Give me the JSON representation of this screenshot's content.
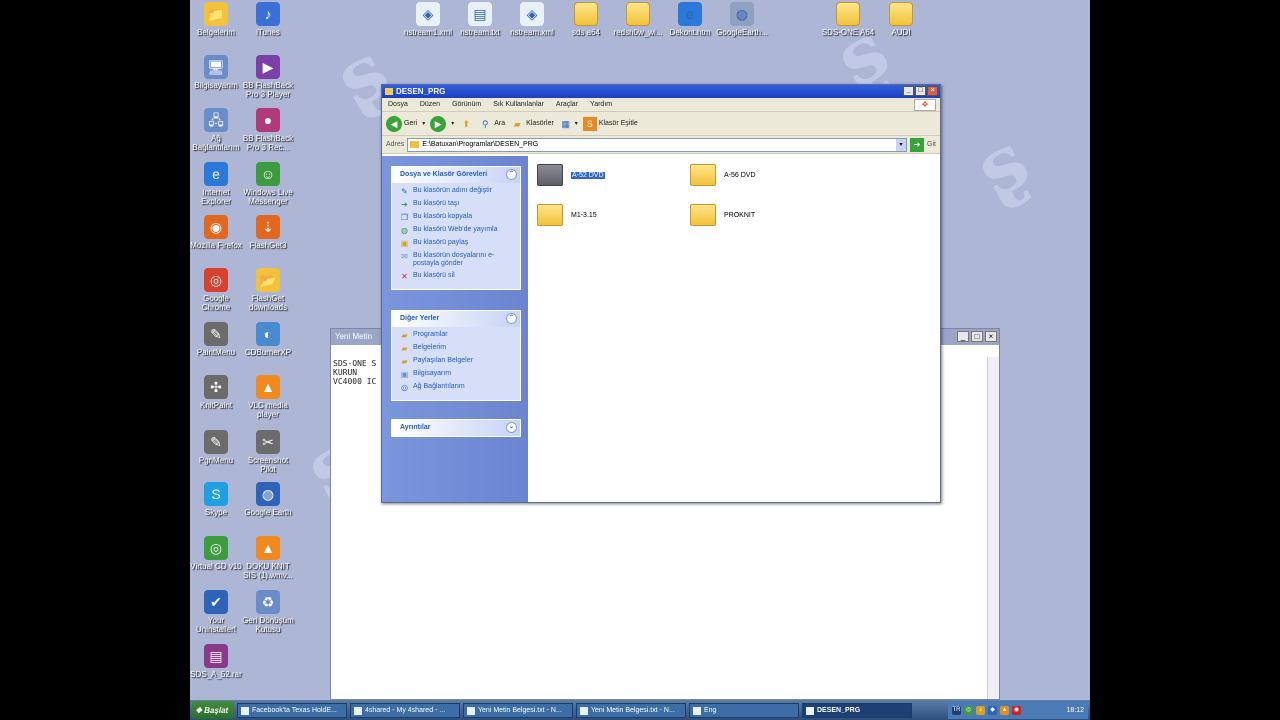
{
  "desktop": {
    "icons": [
      {
        "label": "Belgelerim",
        "glyph": "📁",
        "color": "#f2c23a"
      },
      {
        "label": "iTunes",
        "glyph": "♪",
        "color": "#3a6fd8"
      },
      {
        "label": "Bilgisayarım",
        "glyph": "🖥",
        "color": "#6a8dc8"
      },
      {
        "label": "BB FlashBack Pro 3 Player",
        "glyph": "▶",
        "color": "#7b3fa8"
      },
      {
        "label": "Ağ Bağlantılarım",
        "glyph": "🖧",
        "color": "#6a8dc8"
      },
      {
        "label": "BB FlashBack Pro 3 Rec...",
        "glyph": "●",
        "color": "#b03a7a"
      },
      {
        "label": "Internet Explorer",
        "glyph": "e",
        "color": "#2a78d8"
      },
      {
        "label": "Windows Live Messenger",
        "glyph": "☺",
        "color": "#3d9b40"
      },
      {
        "label": "Mozilla Firefox",
        "glyph": "◉",
        "color": "#e2681f"
      },
      {
        "label": "FlashGet3",
        "glyph": "⇣",
        "color": "#e2681f"
      },
      {
        "label": "Google Chrome",
        "glyph": "◎",
        "color": "#d8402f"
      },
      {
        "label": "FlashGet downloads",
        "glyph": "📂",
        "color": "#f2c23a"
      },
      {
        "label": "PaintMenu",
        "glyph": "✎",
        "color": "#6b6b6b"
      },
      {
        "label": "CDBurnerXP",
        "glyph": "◐",
        "color": "#4a8bd0"
      },
      {
        "label": "KnitPaint",
        "glyph": "✣",
        "color": "#6b6b6b"
      },
      {
        "label": "VLC media player",
        "glyph": "▲",
        "color": "#f08a1e"
      },
      {
        "label": "PgnMenu",
        "glyph": "✎",
        "color": "#6b6b6b"
      },
      {
        "label": "Screenshot Pilot",
        "glyph": "✂",
        "color": "#6b6b6b"
      },
      {
        "label": "Skype",
        "glyph": "S",
        "color": "#1fa0e0"
      },
      {
        "label": "Google Earth",
        "glyph": "◍",
        "color": "#2f63b8"
      },
      {
        "label": "Virtual CD v10",
        "glyph": "◎",
        "color": "#3d9b40"
      },
      {
        "label": "DOKU KNIT SIS (1).wmv...",
        "glyph": "▲",
        "color": "#f08a1e"
      },
      {
        "label": "Your Uninstaller!",
        "glyph": "✔",
        "color": "#2f63b8"
      },
      {
        "label": "Geri Dönüşüm Kutusu",
        "glyph": "♻",
        "color": "#6a8dc8"
      },
      {
        "label": "SDS_A_52.rar",
        "glyph": "▤",
        "color": "#8a3a8a"
      }
    ],
    "top_icons": [
      {
        "label": "nstream1.xml",
        "glyph": "◈",
        "color": "#e8f0f8"
      },
      {
        "label": "nstream.txt",
        "glyph": "▤",
        "color": "#e8f0f8"
      },
      {
        "label": "nstream.xml",
        "glyph": "◈",
        "color": "#e8f0f8"
      },
      {
        "label": "sds a64",
        "glyph": "",
        "color": "#f2c23a"
      },
      {
        "label": "redsh0w_wi...",
        "glyph": "",
        "color": "#f2c23a"
      },
      {
        "label": "Dekont.htm",
        "glyph": "e",
        "color": "#2a78d8"
      },
      {
        "label": "GoogleEarth...",
        "glyph": "◍",
        "color": "#8fa0c0"
      },
      {
        "label": "SDS-ONE A64",
        "glyph": "",
        "color": "#f2c23a"
      },
      {
        "label": "AUDI",
        "glyph": "",
        "color": "#f2c23a"
      }
    ]
  },
  "notepad": {
    "title": "Yeni Metin",
    "text": "SDS-ONE S\nKURUN\nVC4000 IC"
  },
  "explorer": {
    "title": "DESEN_PRG",
    "menu": [
      "Dosya",
      "Düzen",
      "Görünüm",
      "Sık Kullanılanlar",
      "Araçlar",
      "Yardım"
    ],
    "toolbar": {
      "back": "Geri",
      "search": "Ara",
      "folders": "Klasörler",
      "sync": "Klasör Eşitle"
    },
    "address": {
      "label": "Adres",
      "path": "E:\\Batuxan\\Programlar\\DESEN_PRG",
      "go": "Git"
    },
    "tasks": {
      "header": "Dosya ve Klasör Görevleri",
      "items": [
        {
          "label": "Bu klasörün adını değiştir",
          "glyph": "✎",
          "color": "#2f63b8"
        },
        {
          "label": "Bu klasörü taşı",
          "glyph": "➔",
          "color": "#3d9b40"
        },
        {
          "label": "Bu klasörü kopyala",
          "glyph": "❐",
          "color": "#2f63b8"
        },
        {
          "label": "Bu klasörü Web'de yayımla",
          "glyph": "◍",
          "color": "#3d9b40"
        },
        {
          "label": "Bu klasörü paylaş",
          "glyph": "▣",
          "color": "#d8a020"
        },
        {
          "label": "Bu klasörün dosyalarını e-postayla gönder",
          "glyph": "✉",
          "color": "#6a8dc8"
        },
        {
          "label": "Bu klasörü sil",
          "glyph": "✕",
          "color": "#d02020"
        }
      ]
    },
    "places": {
      "header": "Diğer Yerler",
      "items": [
        {
          "label": "Programlar",
          "glyph": "▰",
          "color": "#d8a020"
        },
        {
          "label": "Belgelerim",
          "glyph": "▰",
          "color": "#d8a020"
        },
        {
          "label": "Paylaşılan Belgeler",
          "glyph": "▰",
          "color": "#d8a020"
        },
        {
          "label": "Bilgisayarım",
          "glyph": "▣",
          "color": "#6a8dc8"
        },
        {
          "label": "Ağ Bağlantılarım",
          "glyph": "◎",
          "color": "#2f63b8"
        }
      ]
    },
    "details": {
      "header": "Ayrıntılar"
    },
    "files": [
      {
        "label": "A-52 DVD",
        "dark": true,
        "selected": true
      },
      {
        "label": "A-56 DVD",
        "dark": false,
        "selected": false
      },
      {
        "label": "M1-3.15",
        "dark": false,
        "selected": false
      },
      {
        "label": "PROKNIT",
        "dark": false,
        "selected": false
      }
    ]
  },
  "taskbar": {
    "start": "Başlat",
    "buttons": [
      {
        "label": "Facebook'ta Texas HoldE...",
        "active": false
      },
      {
        "label": "4shared - My 4shared - ...",
        "active": false
      },
      {
        "label": "Yeni Metin Belgesi.txt - N...",
        "active": false
      },
      {
        "label": "Yeni Metin Belgesi.txt - N...",
        "active": false
      },
      {
        "label": "Eng",
        "active": false
      },
      {
        "label": "DESEN_PRG",
        "active": true
      }
    ],
    "lang": "TR",
    "clock": "18:12"
  }
}
